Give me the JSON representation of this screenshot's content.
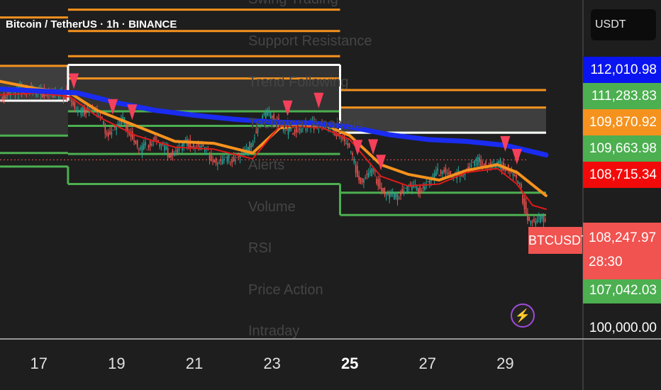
{
  "header": {
    "symbol_title": "Bitcoin / TetherUS · 1h · BINANCE"
  },
  "currency": {
    "label": "USDT"
  },
  "colors": {
    "background": "#1e1e1e",
    "resistance": "#f5921e",
    "support": "#4caf50",
    "pivot": "#ffffff",
    "ema_slow": "#1a2cf0",
    "ema_mid": "#f5921e",
    "ema_fast": "#e01a1a",
    "bull_candle": "#26a69a",
    "bear_candle": "#ef5350",
    "sell_marker": "#f5405a",
    "tag_blue": "#0a14f0",
    "tag_green": "#4caf50",
    "tag_orange": "#f5921e",
    "tag_red": "#f20a0a",
    "tag_last": "#f05350"
  },
  "indicator_menu": [
    "Swing Trading",
    "Support Resistance",
    "Trend Following",
    "Technical Analysis",
    "Alerts",
    "Volume",
    "RSI",
    "Price Action",
    "Intraday"
  ],
  "price_axis": {
    "tags": [
      {
        "label": "112,010.98",
        "color": "tag_blue"
      },
      {
        "label": "111,283.83",
        "color": "tag_green"
      },
      {
        "label": "109,870.92",
        "color": "tag_orange"
      },
      {
        "label": "109,663.98",
        "color": "tag_green"
      },
      {
        "label": "108,715.34",
        "color": "tag_red"
      },
      {
        "label": "107,042.03",
        "color": "tag_green"
      }
    ],
    "last_price": "108,247.97",
    "countdown": "28:30",
    "symbol_label": "BTCUSDT",
    "bottom_tick": "100,000.00"
  },
  "chart_data": {
    "type": "line",
    "title": "Bitcoin / TetherUS · 1h · BINANCE",
    "x_tick_labels": [
      "17",
      "19",
      "21",
      "23",
      "25",
      "27",
      "29"
    ],
    "bold_tick": "25",
    "x_range": [
      16.0,
      31.0
    ],
    "y_range": [
      99000,
      116500
    ],
    "last_price": 108247.97,
    "levels": {
      "resistance": [
        {
          "x": [
            16.0,
            17.75
          ],
          "y": [
            115600,
            113100
          ]
        },
        {
          "x": [
            17.75,
            24.75
          ],
          "y": [
            116000,
            114900,
            113600,
            112450
          ]
        },
        {
          "x": [
            24.75,
            30.05
          ],
          "y": [
            111850,
            110950
          ]
        }
      ],
      "support": [
        {
          "x": [
            16.0,
            17.75
          ],
          "y": [
            109500,
            108600,
            107900
          ]
        },
        {
          "x": [
            17.75,
            24.75
          ],
          "y": [
            110750,
            110000,
            108550,
            107000
          ]
        },
        {
          "x": [
            24.75,
            30.05
          ],
          "y": [
            109650,
            106550,
            105400
          ]
        }
      ],
      "pivot": [
        {
          "x": [
            16.0,
            17.75
          ],
          "y": [
            111300
          ]
        },
        {
          "x": [
            17.75,
            24.75
          ],
          "y": [
            113150
          ]
        },
        {
          "x": [
            24.75,
            30.05
          ],
          "y": [
            109650
          ]
        }
      ]
    },
    "series": [
      {
        "role": "ema_slow",
        "x": [
          16.0,
          17.0,
          18.0,
          19.0,
          20.0,
          21.0,
          22.0,
          23.0,
          24.0,
          25.0,
          26.0,
          27.0,
          28.0,
          29.0,
          30.05
        ],
        "y": [
          111900,
          111800,
          111700,
          111200,
          110800,
          110550,
          110350,
          110200,
          110150,
          109950,
          109550,
          109300,
          109200,
          109000,
          108500
        ]
      },
      {
        "role": "ema_mid",
        "x": [
          16.0,
          17.0,
          17.8,
          18.5,
          19.5,
          20.5,
          21.5,
          22.5,
          23.2,
          24.3,
          25.0,
          25.8,
          26.5,
          27.3,
          28.0,
          28.8,
          29.3,
          30.05
        ],
        "y": [
          112300,
          111900,
          111700,
          110800,
          110000,
          109200,
          109100,
          108600,
          109900,
          110100,
          109500,
          108000,
          107500,
          107200,
          107700,
          108000,
          107600,
          106400
        ]
      },
      {
        "role": "ema_fast",
        "x": [
          16.0,
          17.0,
          17.8,
          18.5,
          19.5,
          20.5,
          21.5,
          22.5,
          23.2,
          24.3,
          25.0,
          25.8,
          26.5,
          27.3,
          28.0,
          28.8,
          29.3,
          29.7,
          30.05
        ],
        "y": [
          111600,
          111700,
          111500,
          110500,
          109500,
          108900,
          108800,
          108300,
          110000,
          109900,
          109300,
          107400,
          106900,
          107000,
          107600,
          107800,
          107000,
          105900,
          105700
        ]
      },
      {
        "role": "price",
        "x": [
          16.0,
          16.6,
          17.2,
          17.8,
          18.0,
          18.4,
          18.8,
          19.2,
          19.6,
          20.0,
          20.4,
          20.8,
          21.2,
          21.6,
          22.0,
          22.4,
          22.6,
          22.8,
          23.0,
          23.4,
          23.8,
          24.2,
          24.6,
          24.8,
          25.0,
          25.3,
          25.6,
          25.9,
          26.2,
          26.5,
          26.8,
          27.1,
          27.4,
          27.7,
          28.0,
          28.3,
          28.6,
          28.9,
          29.2,
          29.4,
          29.6,
          29.8,
          30.05
        ],
        "y": [
          111500,
          111900,
          111700,
          111600,
          110600,
          111000,
          109600,
          110300,
          108700,
          109300,
          108500,
          109100,
          108900,
          108100,
          108300,
          108700,
          109700,
          110600,
          110500,
          109700,
          109900,
          110100,
          109800,
          109500,
          108800,
          107100,
          107700,
          106500,
          106300,
          106900,
          106700,
          107200,
          107800,
          107300,
          107700,
          108200,
          107900,
          108000,
          107600,
          106800,
          105200,
          105000,
          105300
        ]
      }
    ],
    "sell_signals_x": [
      17.9,
      18.9,
      19.4,
      23.4,
      24.2,
      25.2,
      25.6,
      25.8,
      29.0,
      29.3
    ]
  }
}
